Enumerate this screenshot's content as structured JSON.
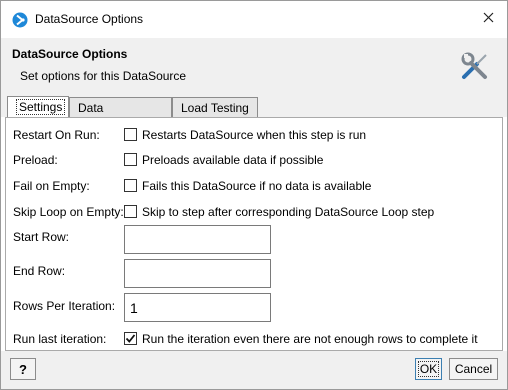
{
  "window": {
    "title": "DataSource Options",
    "icon": "readyapi-logo-icon",
    "close_icon": "close-icon"
  },
  "header": {
    "title": "DataSource Options",
    "subtitle": "Set options for this DataSource",
    "icon": "tools-icon"
  },
  "tabs": [
    {
      "label": "Settings",
      "active": true
    },
    {
      "label": "Data Processing",
      "active": false
    },
    {
      "label": "Load Testing",
      "active": false
    }
  ],
  "settings": {
    "restart_on_run": {
      "label": "Restart On Run:",
      "checkbox_label": "Restarts DataSource when this step is run",
      "checked": false
    },
    "preload": {
      "label": "Preload:",
      "checkbox_label": "Preloads available data if possible",
      "checked": false
    },
    "fail_on_empty": {
      "label": "Fail on Empty:",
      "checkbox_label": "Fails this DataSource if no data is available",
      "checked": false
    },
    "skip_loop_on_empty": {
      "label": "Skip Loop on Empty:",
      "checkbox_label": "Skip to step after corresponding DataSource Loop step",
      "checked": false
    },
    "start_row": {
      "label": "Start Row:",
      "value": ""
    },
    "end_row": {
      "label": "End Row:",
      "value": ""
    },
    "rows_per_iteration": {
      "label": "Rows Per Iteration:",
      "value": "1"
    },
    "run_last_iteration": {
      "label": "Run last iteration:",
      "checkbox_label": "Run the iteration even there are not enough rows to complete it",
      "checked": true
    }
  },
  "footer": {
    "help_label": "?",
    "ok_label": "OK",
    "cancel_label": "Cancel"
  },
  "colors": {
    "accent": "#3c7fb1",
    "logo_blue": "#1e88d8",
    "panel_bg": "#f0f0f0"
  }
}
